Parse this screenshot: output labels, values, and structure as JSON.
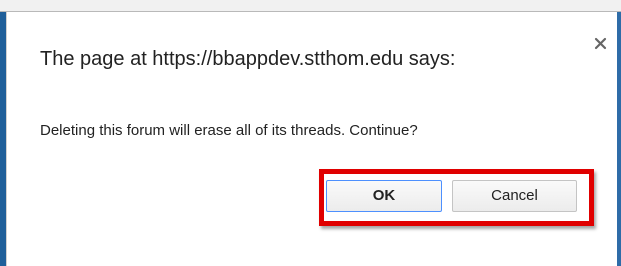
{
  "dialog": {
    "title": "The page at https://bbappdev.stthom.edu says:",
    "message": "Deleting this forum will erase all of its threads. Continue?",
    "close_icon": "close-icon"
  },
  "buttons": {
    "ok_label": "OK",
    "cancel_label": "Cancel"
  },
  "colors": {
    "highlight": "#e00000",
    "frame_accent": "#1f5f9a",
    "ok_focus_border": "#4d90fe"
  }
}
